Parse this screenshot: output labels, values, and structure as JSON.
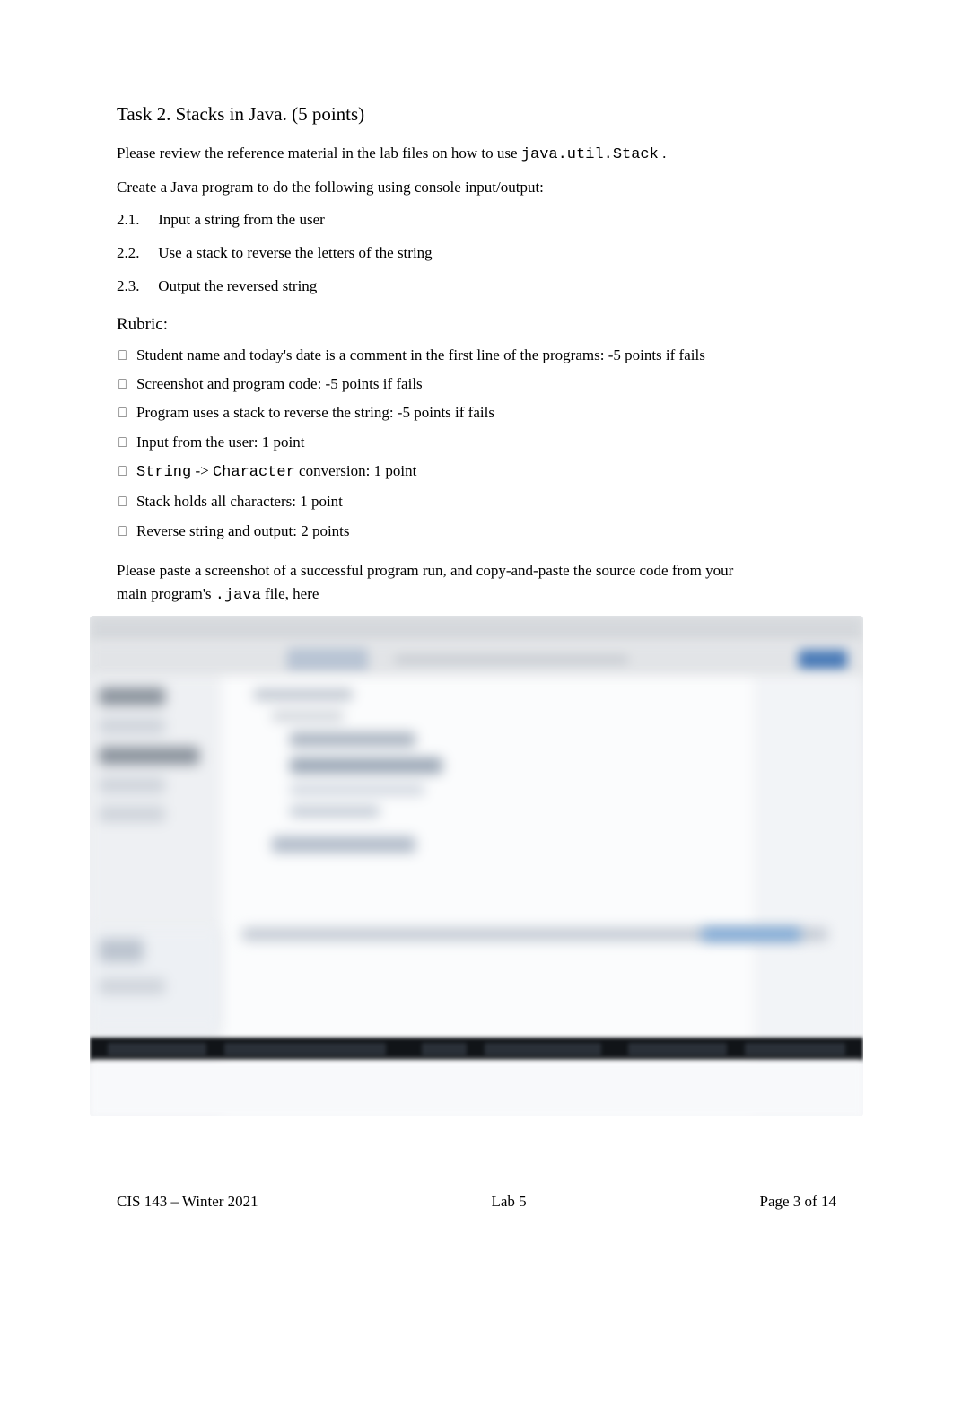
{
  "task": {
    "title": "Task 2.  Stacks in Java. (5 points)",
    "intro_prefix": "Please review the reference material in the lab files on how to use   ",
    "intro_code": "java.util.Stack",
    "intro_suffix": "             .",
    "create_line": "Create a Java program to do the following using console input/output:",
    "steps": [
      {
        "num": "2.1.",
        "text": "Input a string from the user"
      },
      {
        "num": "2.2.",
        "text": "Use a stack to reverse the letters of the string"
      },
      {
        "num": "2.3.",
        "text": "Output the reversed string"
      }
    ]
  },
  "rubric": {
    "title": "Rubric:",
    "items": [
      "Student name and today's date is a comment in the first line of the programs: -5 points if fails",
      "Screenshot and program code: -5 points if fails",
      "Program uses a stack to reverse the string: -5 points if fails",
      "Input from the user: 1 point"
    ],
    "conversion_item": {
      "code_a": "String",
      "arrow": "    -> ",
      "code_b": "Character",
      "suffix": "     conversion: 1 point"
    },
    "tail_items": [
      "Stack holds all characters: 1 point",
      "Reverse string and output: 2 points"
    ]
  },
  "paste": {
    "line1": "Please paste a screenshot of a successful program run, and copy-and-paste the source code from your",
    "line2_prefix": "main program's ",
    "line2_code": ".java",
    "line2_suffix": "   file, here"
  },
  "footer": {
    "left": "CIS 143 – Winter 2021",
    "center": "Lab 5",
    "right": "Page 3 of 14"
  },
  "bullet_glyph": "⎕"
}
